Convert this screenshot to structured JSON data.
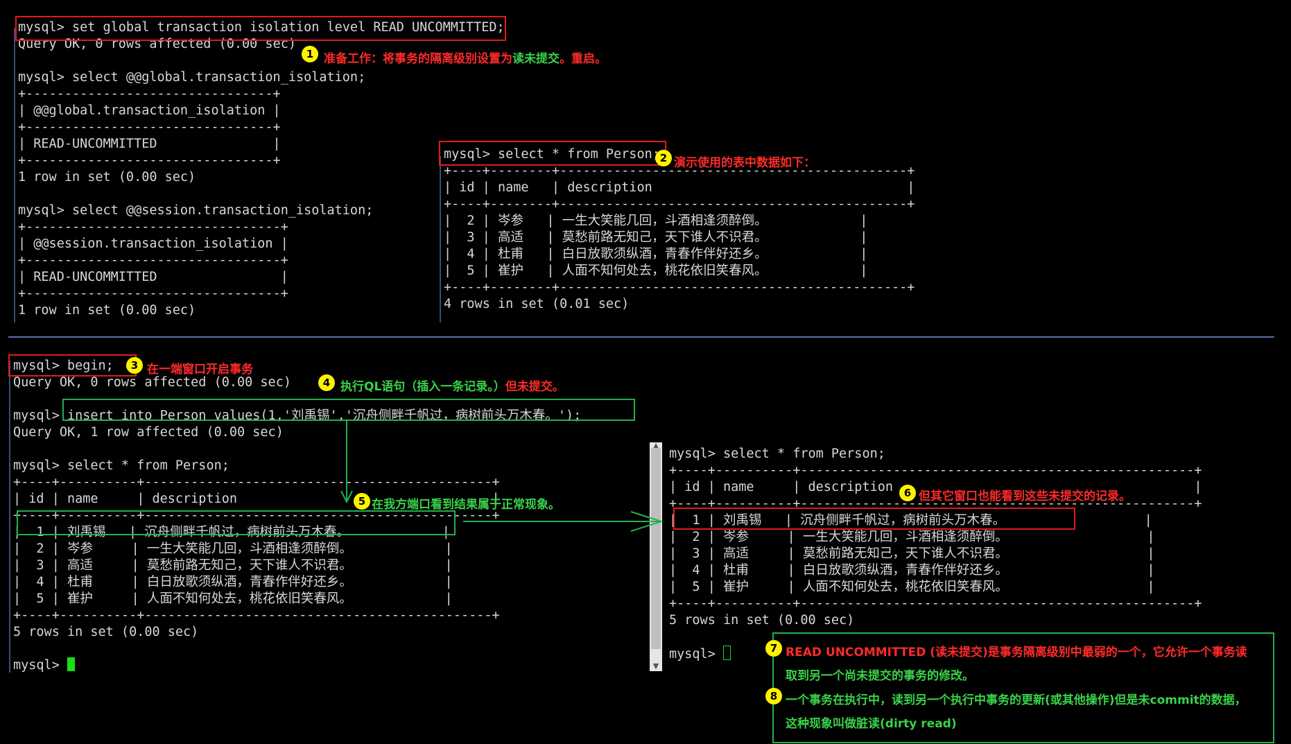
{
  "colors": {
    "annotation_red": "#ff2a2a",
    "annotation_green": "#39d24a",
    "badge": "#fff200",
    "terminal_bg": "#000000",
    "cursor": "#18e018"
  },
  "terminal_top_left": [
    "mysql> set global transaction isolation level READ UNCOMMITTED;",
    "Query OK, 0 rows affected (0.00 sec)",
    "",
    "mysql> select @@global.transaction_isolation;",
    "+--------------------------------+",
    "| @@global.transaction_isolation |",
    "+--------------------------------+",
    "| READ-UNCOMMITTED               |",
    "+--------------------------------+",
    "1 row in set (0.00 sec)",
    "",
    "mysql> select @@session.transaction_isolation;",
    "+---------------------------------+",
    "| @@session.transaction_isolation |",
    "+---------------------------------+",
    "| READ-UNCOMMITTED                |",
    "+---------------------------------+",
    "1 row in set (0.00 sec)"
  ],
  "terminal_top_right": [
    "mysql> select * from Person;",
    "+----+--------+---------------------------------------------+",
    "| id | name   | description                                 |",
    "+----+--------+---------------------------------------------+",
    "|  2 | 岑参   | 一生大笑能几回，斗酒相逢须醉倒。            |",
    "|  3 | 高适   | 莫愁前路无知己，天下谁人不识君。            |",
    "|  4 | 杜甫   | 白日放歌须纵酒，青春作伴好还乡。            |",
    "|  5 | 崔护   | 人面不知何处去，桃花依旧笑春风。            |",
    "+----+--------+---------------------------------------------+",
    "4 rows in set (0.01 sec)"
  ],
  "terminal_bottom_left": [
    "mysql> begin;",
    "Query OK, 0 rows affected (0.00 sec)",
    "",
    "mysql> insert into Person values(1,'刘禹锡','沉舟侧畔千帆过，病树前头万木春。');",
    "Query OK, 1 row affected (0.00 sec)",
    "",
    "mysql> select * from Person;",
    "+----+----------+---------------------------------------------+",
    "| id | name     | description                                 |",
    "+----+----------+---------------------------------------------+",
    "|  1 | 刘禹锡   | 沉舟侧畔千帆过，病树前头万木春。            |",
    "|  2 | 岑参     | 一生大笑能几回，斗酒相逢须醉倒。            |",
    "|  3 | 高适     | 莫愁前路无知己，天下谁人不识君。            |",
    "|  4 | 杜甫     | 白日放歌须纵酒，青春作伴好还乡。            |",
    "|  5 | 崔护     | 人面不知何处去，桃花依旧笑春风。            |",
    "+----+----------+---------------------------------------------+",
    "5 rows in set (0.00 sec)",
    "",
    "mysql> "
  ],
  "terminal_bottom_right": [
    "mysql> select * from Person;",
    "+----+----------+---------------------------------------------------+",
    "| id | name     | description                                       |",
    "+----+----------+---------------------------------------------------+",
    "|  1 | 刘禹锡   | 沉舟侧畔千帆过，病树前头万木春。                  |",
    "|  2 | 岑参     | 一生大笑能几回，斗酒相逢须醉倒。                  |",
    "|  3 | 高适     | 莫愁前路无知己，天下谁人不识君。                  |",
    "|  4 | 杜甫     | 白日放歌须纵酒，青春作伴好还乡。                  |",
    "|  5 | 崔护     | 人面不知何处去，桃花依旧笑春风。                  |",
    "+----+----------+---------------------------------------------------+",
    "5 rows in set (0.00 sec)",
    "",
    "mysql> "
  ],
  "annotations": {
    "a1": {
      "num": "1",
      "text_red": "准备工作：将事务的隔离级别设置为",
      "text_green": "读未提交",
      "text_red2": "。重启。"
    },
    "a2": {
      "num": "2",
      "text": "演示使用的表中数据如下："
    },
    "a3": {
      "num": "3",
      "text": "在一端窗口开启事务"
    },
    "a4": {
      "num": "4",
      "text": "执行QL语句（插入一条记录。）",
      "text_red": "但未提交。"
    },
    "a5": {
      "num": "5",
      "text": "在我方端口看到结果属于正常现象。"
    },
    "a6": {
      "num": "6",
      "text": "但其它窗口也能看到这些未提交的记录。"
    },
    "a7": {
      "num": "7",
      "text_red": "READ UNCOMMITTED (读未提交)是事务隔离级别中最弱的一个，它",
      "text_green": "允许一个事务读",
      "text_green2": "取到另一个尚未提交的事务的修改。"
    },
    "a8": {
      "num": "8",
      "text_green": "一个事务在执行中，读到另一个执行中事务的更新(或其他操作)但是未commit的数据，",
      "text_green2": "这种现象叫做脏读(dirty read)"
    }
  },
  "scrollbar": {
    "up_arrow": "▲",
    "down_arrow": "▼"
  }
}
